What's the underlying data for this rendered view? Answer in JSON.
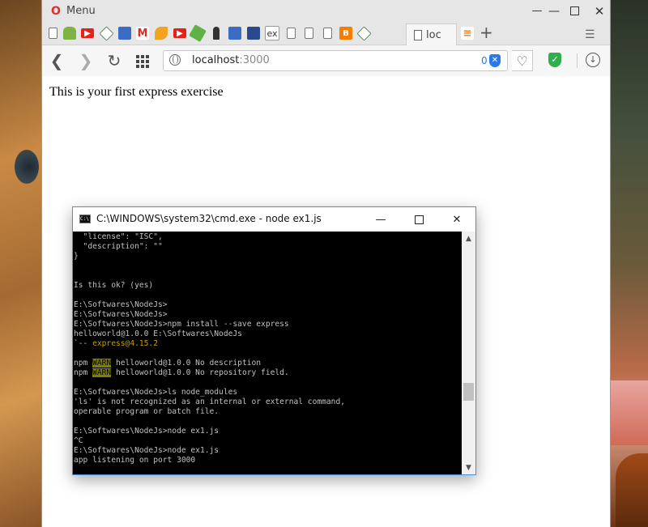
{
  "browser": {
    "menu_label": "Menu",
    "active_tab_title": "loc",
    "tab_icons": [
      "page-icon",
      "android-icon",
      "youtube-icon",
      "extension-icon",
      "box-icon",
      "gmail-icon",
      "swirl-icon",
      "youtube-icon",
      "node-icon",
      "figure-icon",
      "box-icon",
      "books-icon",
      "ex-icon",
      "page-icon",
      "page-icon",
      "page-icon",
      "blogger-icon",
      "extension-icon"
    ],
    "ex_tab_label": "ex",
    "url_host": "localhost",
    "url_port": ":3000",
    "adblock_count": "0",
    "page_text": "This is your first express exercise",
    "colors": {
      "adblock": "#2c7be5",
      "vpn": "#2fae4a",
      "opera": "#e0302a"
    }
  },
  "cmd": {
    "title": "C:\\WINDOWS\\system32\\cmd.exe - node  ex1.js",
    "lines": [
      "  \"license\": \"ISC\",",
      "  \"description\": \"\"",
      "}",
      "",
      "",
      "Is this ok? (yes)",
      "",
      "E:\\Softwares\\NodeJs>",
      "E:\\Softwares\\NodeJs>",
      "E:\\Softwares\\NodeJs>npm install --save express",
      "helloworld@1.0.0 E:\\Softwares\\NodeJs",
      "`-- express@4.15.2",
      "",
      "npm WARN helloworld@1.0.0 No description",
      "npm WARN helloworld@1.0.0 No repository field.",
      "",
      "E:\\Softwares\\NodeJs>ls node_modules",
      "'ls' is not recognized as an internal or external command,",
      "operable program or batch file.",
      "",
      "E:\\Softwares\\NodeJs>node ex1.js",
      "^C",
      "E:\\Softwares\\NodeJs>node ex1.js",
      "app listening on port 3000"
    ]
  }
}
